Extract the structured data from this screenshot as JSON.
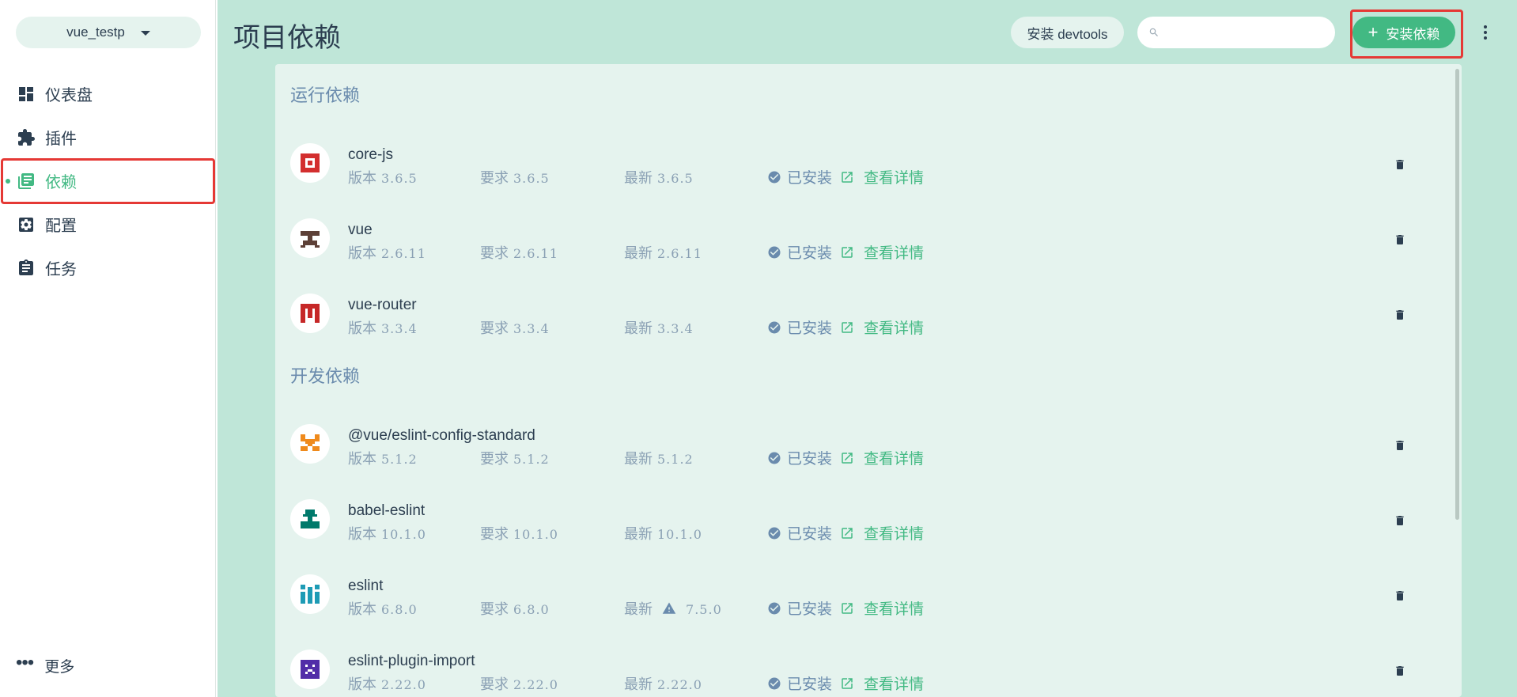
{
  "project": {
    "name": "vue_testp"
  },
  "nav": [
    {
      "label": "仪表盘",
      "icon": "dashboard-icon"
    },
    {
      "label": "插件",
      "icon": "puzzle-icon"
    },
    {
      "label": "依赖",
      "icon": "library-icon",
      "active": true
    },
    {
      "label": "配置",
      "icon": "gear-icon"
    },
    {
      "label": "任务",
      "icon": "clipboard-icon"
    }
  ],
  "more_label": "更多",
  "header": {
    "title": "项目依赖",
    "devtools_label": "安装 devtools",
    "search_placeholder": "",
    "install_label": "安装依赖"
  },
  "labels": {
    "version": "版本",
    "required": "要求",
    "latest": "最新",
    "installed": "已安装",
    "details": "查看详情"
  },
  "sections": [
    {
      "title": "运行依赖",
      "packages": [
        {
          "name": "core-js",
          "version": "3.6.5",
          "required": "3.6.5",
          "latest": "3.6.5",
          "icon_color": "#d32f2f"
        },
        {
          "name": "vue",
          "version": "2.6.11",
          "required": "2.6.11",
          "latest": "2.6.11",
          "icon_color": "#5d4037"
        },
        {
          "name": "vue-router",
          "version": "3.3.4",
          "required": "3.3.4",
          "latest": "3.3.4",
          "icon_color": "#c62828"
        }
      ]
    },
    {
      "title": "开发依赖",
      "packages": [
        {
          "name": "@vue/eslint-config-standard",
          "version": "5.1.2",
          "required": "5.1.2",
          "latest": "5.1.2",
          "icon_color": "#ef8a1c"
        },
        {
          "name": "babel-eslint",
          "version": "10.1.0",
          "required": "10.1.0",
          "latest": "10.1.0",
          "icon_color": "#00796b"
        },
        {
          "name": "eslint",
          "version": "6.8.0",
          "required": "6.8.0",
          "latest": "7.5.0",
          "latest_warning": true,
          "icon_color": "#1e9bb5"
        },
        {
          "name": "eslint-plugin-import",
          "version": "2.22.0",
          "required": "2.22.0",
          "latest": "2.22.0",
          "icon_color": "#512da8"
        }
      ]
    }
  ],
  "colors": {
    "accent": "#42b983",
    "main_bg": "#bfe6d8",
    "panel_bg": "#e5f3ee",
    "text": "#2c3e50",
    "muted": "#6a8bad",
    "highlight": "#e53935"
  }
}
